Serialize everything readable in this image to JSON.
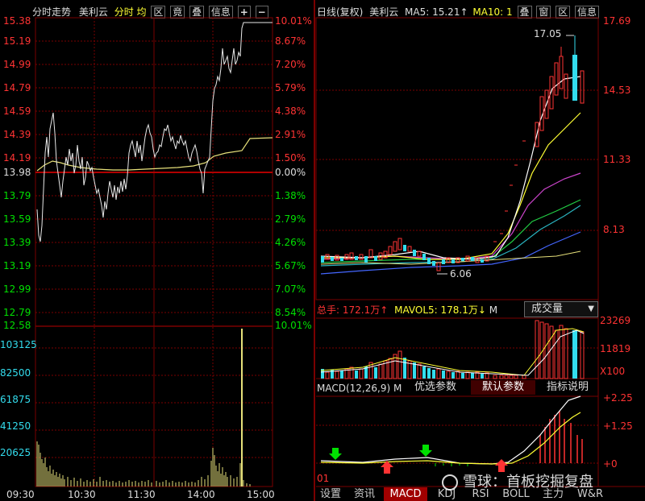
{
  "intraday": {
    "title": "分时走势",
    "stock_name": "美利云",
    "buttons": [
      "分时",
      "均",
      "区",
      "竟",
      "叠",
      "信息",
      "+",
      "−"
    ],
    "price_labels": [
      "15.38",
      "15.19",
      "14.99",
      "14.79",
      "14.59",
      "14.39",
      "14.19",
      "13.98",
      "13.79",
      "13.59",
      "13.39",
      "13.19",
      "12.99",
      "12.79",
      "12.58"
    ],
    "pct_labels": [
      "10.01%",
      "8.67%",
      "7.20%",
      "5.79%",
      "4.38%",
      "2.91%",
      "1.50%",
      "0.00%",
      "1.38%",
      "2.79%",
      "4.26%",
      "5.67%",
      "7.07%",
      "8.54%",
      "10.01%"
    ],
    "volume_labels": [
      "103125",
      "82500",
      "61875",
      "41250",
      "20625"
    ],
    "time_labels": [
      "09:30",
      "10:30",
      "11:30",
      "14:00",
      "15:00"
    ]
  },
  "daily": {
    "title": "日线(复权)",
    "stock_name": "美利云",
    "ma5_label": "MA5: 15.21↑",
    "ma10_label": "MA10: 1",
    "buttons": [
      "叠",
      "窗",
      "区",
      "信息"
    ],
    "price_labels": [
      "17.69",
      "14.53",
      "11.33",
      "8.13"
    ],
    "high_annotation": "17.05",
    "low_annotation": "6.06",
    "volume_header": "总手: 172.1万↑",
    "mavol_header": "MAVOL5: 178.1万↓",
    "mavol_trunc": "M",
    "volume_dropdown": "成交量",
    "volume_labels": [
      "23269",
      "11819",
      "X100"
    ],
    "macd_header": "MACD(12,26,9)",
    "macd_trunc": "M",
    "macd_tabs": [
      "优选参数",
      "默认参数",
      "指标说明"
    ],
    "macd_labels": [
      "+2.25",
      "+1.25",
      "+0"
    ]
  },
  "bottom_tabs": [
    "01",
    "设置",
    "资讯",
    "MACD",
    "KDJ",
    "RSI",
    "BOLL",
    "主力",
    "W&R"
  ],
  "watermark": "雪球：首板挖掘复盘",
  "colors": {
    "up": "#ff3333",
    "down": "#00e000",
    "avg": "#e6e07a",
    "cyan": "#33ddee",
    "grid": "#7a0000"
  }
}
